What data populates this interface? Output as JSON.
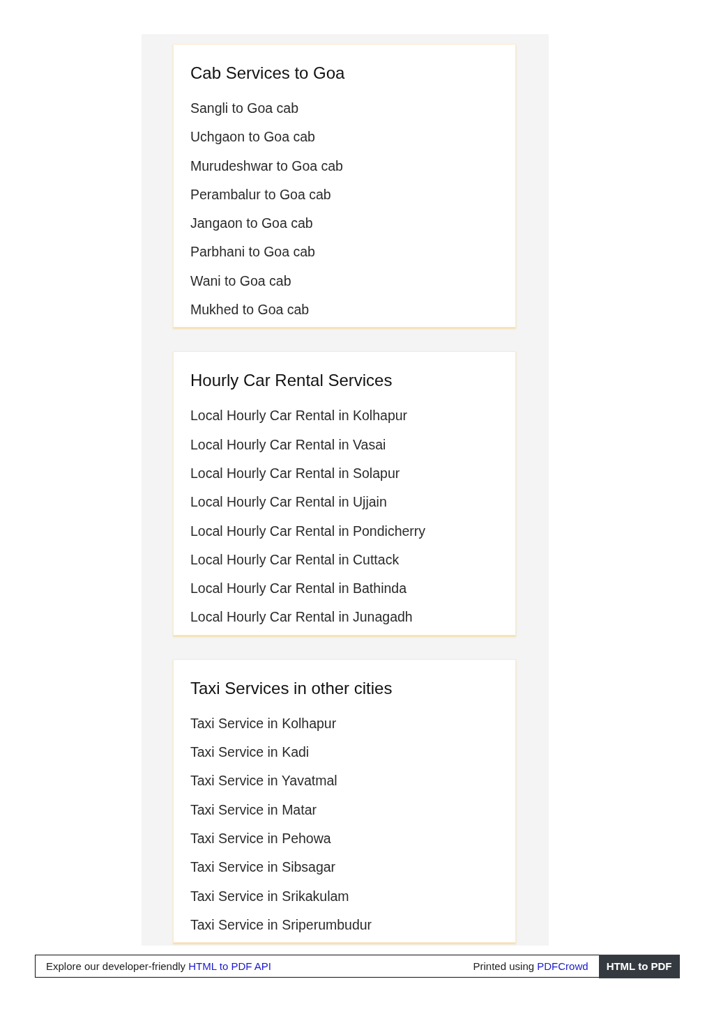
{
  "sections": [
    {
      "title": "Cab Services to Goa",
      "links": [
        "Sangli to Goa cab",
        "Uchgaon to Goa cab",
        "Murudeshwar to Goa cab",
        "Perambalur to Goa cab",
        "Jangaon to Goa cab",
        "Parbhani to Goa cab",
        "Wani to Goa cab",
        "Mukhed to Goa cab"
      ]
    },
    {
      "title": "Hourly Car Rental Services",
      "links": [
        "Local Hourly Car Rental in Kolhapur",
        "Local Hourly Car Rental in Vasai",
        "Local Hourly Car Rental in Solapur",
        "Local Hourly Car Rental in Ujjain",
        "Local Hourly Car Rental in Pondicherry",
        "Local Hourly Car Rental in Cuttack",
        "Local Hourly Car Rental in Bathinda",
        "Local Hourly Car Rental in Junagadh"
      ]
    },
    {
      "title": "Taxi Services in other cities",
      "links": [
        "Taxi Service in Kolhapur",
        "Taxi Service in Kadi",
        "Taxi Service in Yavatmal",
        "Taxi Service in Matar",
        "Taxi Service in Pehowa",
        "Taxi Service in Sibsagar",
        "Taxi Service in Srikakulam",
        "Taxi Service in Sriperumbudur"
      ]
    }
  ],
  "footer": {
    "left_text": "Explore our developer-friendly",
    "left_link": "HTML to PDF API",
    "right_text": "Printed using",
    "right_link": "PDFCrowd",
    "button": "HTML to PDF"
  }
}
